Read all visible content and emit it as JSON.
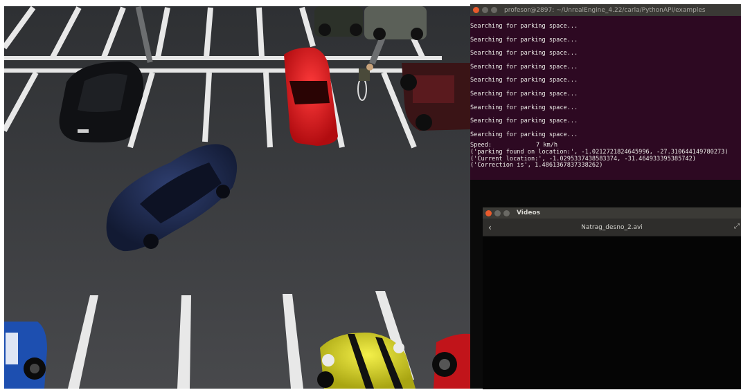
{
  "terminal": {
    "title": "profesor@2897: ~/UnrealEngine_4.22/carla/PythonAPI/examples",
    "search_lines": [
      "Searching for parking space...",
      "Searching for parking space...",
      "Searching for parking space...",
      "Searching for parking space...",
      "Searching for parking space...",
      "Searching for parking space...",
      "Searching for parking space...",
      "Searching for parking space...",
      "Searching for parking space..."
    ],
    "speed_label": "Speed:",
    "speed_value": "7 km/h",
    "parking_found": "('parking found on location:', -1.0212721824645996, -27.310644149780273)",
    "current_location": "('Current location:', -1.0295337438583374, -31.464933395385742)",
    "correction": "('Correction is', 1.4861367837338262)"
  },
  "videos": {
    "title": "Videos",
    "back": "‹",
    "filename": "Natrag_desno_2.avi",
    "expand": "⤢"
  },
  "colors": {
    "terminal_bg": "#2d0922",
    "asphalt": "#3b3d40",
    "close_button": "#e95a2c"
  }
}
